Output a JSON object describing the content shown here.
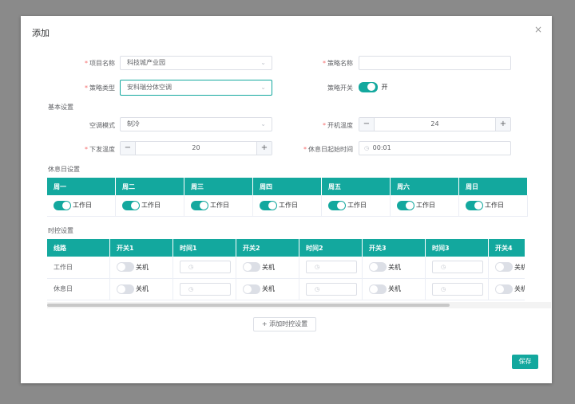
{
  "dialog": {
    "title": "添加",
    "close": "×"
  },
  "form": {
    "project_label": "项目名称",
    "project_value": "科技城产业园",
    "strategy_name_label": "策略名称",
    "strategy_name_value": "",
    "strategy_type_label": "策略类型",
    "strategy_type_value": "安科瑞分体空调",
    "strategy_switch_label": "策略开关",
    "strategy_switch_state": "开",
    "basic_section": "基本设置",
    "ac_mode_label": "空调模式",
    "ac_mode_value": "制冷",
    "boot_temp_label": "开机温度",
    "boot_temp_value": "24",
    "send_temp_label": "下发温度",
    "send_temp_value": "20",
    "rest_start_label": "休息日起始时间",
    "rest_start_value": "00:01",
    "minus": "−",
    "plus": "+",
    "chevron": "⌄"
  },
  "restday": {
    "section": "休息日设置",
    "headers": [
      "周一",
      "周二",
      "周三",
      "周四",
      "周五",
      "周六",
      "周日"
    ],
    "cell_label": "工作日"
  },
  "timecontrol": {
    "section": "时控设置",
    "headers": [
      "线路",
      "开关1",
      "时间1",
      "开关2",
      "时间2",
      "开关3",
      "时间3",
      "开关4"
    ],
    "rows": [
      {
        "name": "工作日",
        "switch_label": "关机"
      },
      {
        "name": "休息日",
        "switch_label": "关机"
      }
    ],
    "clock": "◷"
  },
  "buttons": {
    "add_timecontrol": "+ 添加时控设置",
    "save": "保存"
  },
  "colors": {
    "accent": "#13a89e",
    "required": "#f56c6c"
  }
}
